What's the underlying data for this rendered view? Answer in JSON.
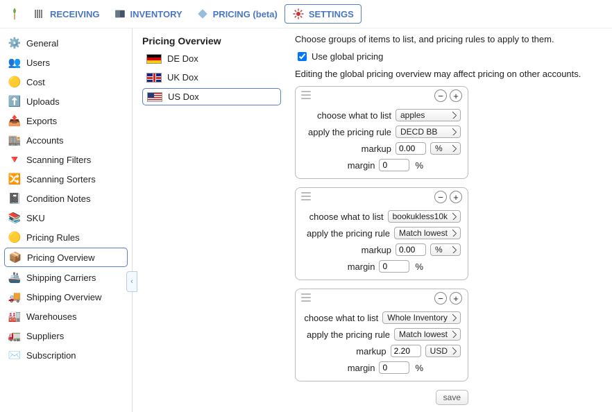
{
  "topnav": {
    "tabs": [
      {
        "label": "RECEIVING",
        "active": false
      },
      {
        "label": "INVENTORY",
        "active": false
      },
      {
        "label": "PRICING (beta)",
        "active": false
      },
      {
        "label": "SETTINGS",
        "active": true
      }
    ]
  },
  "sidebar": {
    "items": [
      {
        "label": "General",
        "icon": "⚙️"
      },
      {
        "label": "Users",
        "icon": "👥"
      },
      {
        "label": "Cost",
        "icon": "🟡"
      },
      {
        "label": "Uploads",
        "icon": "⬆️"
      },
      {
        "label": "Exports",
        "icon": "📤"
      },
      {
        "label": "Accounts",
        "icon": "🏬"
      },
      {
        "label": "Scanning Filters",
        "icon": "🔻"
      },
      {
        "label": "Scanning Sorters",
        "icon": "🔀"
      },
      {
        "label": "Condition Notes",
        "icon": "📓"
      },
      {
        "label": "SKU",
        "icon": "📚"
      },
      {
        "label": "Pricing Rules",
        "icon": "🟡"
      },
      {
        "label": "Pricing Overview",
        "icon": "📦",
        "selected": true
      },
      {
        "label": "Shipping Carriers",
        "icon": "🚢"
      },
      {
        "label": "Shipping Overview",
        "icon": "🚚"
      },
      {
        "label": "Warehouses",
        "icon": "🏭"
      },
      {
        "label": "Suppliers",
        "icon": "🚛"
      },
      {
        "label": "Subscription",
        "icon": "✉️"
      }
    ]
  },
  "groups": {
    "heading": "Pricing Overview",
    "items": [
      {
        "label": "DE Dox",
        "flag": "de"
      },
      {
        "label": "UK Dox",
        "flag": "uk"
      },
      {
        "label": "US Dox",
        "flag": "us",
        "selected": true
      }
    ]
  },
  "panel": {
    "description": "Choose groups of items to list, and pricing rules to apply to them.",
    "global_checkbox_label": "Use global pricing",
    "global_checked": true,
    "warning": "Editing the global pricing overview may affect pricing on other accounts.",
    "labels": {
      "what_to_list": "choose what to list",
      "apply_rule": "apply the pricing rule",
      "markup": "markup",
      "margin": "margin",
      "percent": "%"
    },
    "remove_btn": "−",
    "add_btn": "+",
    "rules": [
      {
        "what": "apples",
        "rule": "DECD BB",
        "markup": "0.00",
        "markup_unit": "%",
        "margin": "0"
      },
      {
        "what": "bookukless10k",
        "rule": "Match lowest",
        "markup": "0.00",
        "markup_unit": "%",
        "margin": "0"
      },
      {
        "what": "Whole Inventory",
        "rule": "Match lowest",
        "markup": "2.20",
        "markup_unit": "USD",
        "margin": "0"
      }
    ],
    "save_label": "save"
  }
}
